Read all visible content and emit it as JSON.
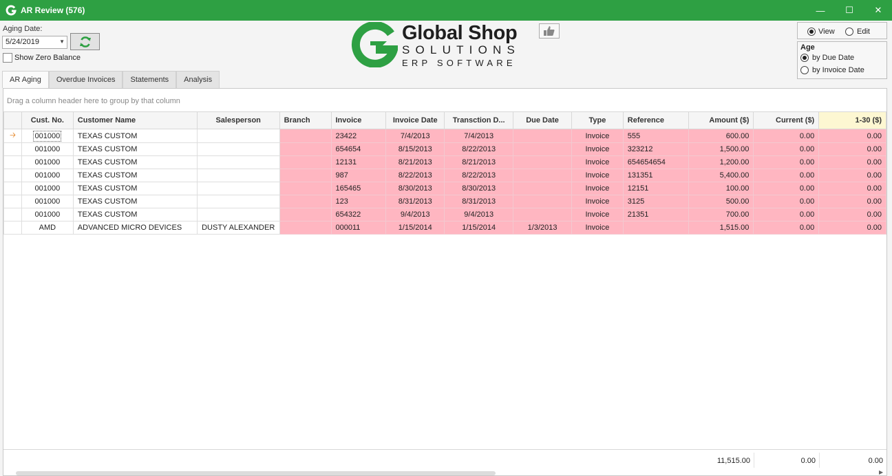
{
  "window": {
    "title": "AR Review (576)"
  },
  "aging": {
    "label": "Aging Date:",
    "date": "5/24/2019",
    "show_zero_label": "Show Zero Balance"
  },
  "logo": {
    "line1": "Global Shop",
    "line2": "SOLUTIONS",
    "line3": "ERP SOFTWARE"
  },
  "mode": {
    "view": "View",
    "edit": "Edit"
  },
  "age": {
    "title": "Age",
    "by_due": "by Due Date",
    "by_invoice": "by Invoice Date"
  },
  "tabs": [
    "AR Aging",
    "Overdue Invoices",
    "Statements",
    "Analysis"
  ],
  "grid": {
    "group_hint": "Drag a column header here to group by that column",
    "columns": [
      "Cust. No.",
      "Customer Name",
      "Salesperson",
      "Branch",
      "Invoice",
      "Invoice Date",
      "Transction D...",
      "Due Date",
      "Type",
      "Reference",
      "Amount ($)",
      "Current ($)",
      "1-30 ($)"
    ],
    "rows": [
      [
        "001000",
        "TEXAS CUSTOM",
        "",
        "",
        "23422",
        "7/4/2013",
        "7/4/2013",
        "",
        "Invoice",
        "555",
        "600.00",
        "0.00",
        "0.00"
      ],
      [
        "001000",
        "TEXAS CUSTOM",
        "",
        "",
        "654654",
        "8/15/2013",
        "8/22/2013",
        "",
        "Invoice",
        "323212",
        "1,500.00",
        "0.00",
        "0.00"
      ],
      [
        "001000",
        "TEXAS CUSTOM",
        "",
        "",
        "12131",
        "8/21/2013",
        "8/21/2013",
        "",
        "Invoice",
        "654654654",
        "1,200.00",
        "0.00",
        "0.00"
      ],
      [
        "001000",
        "TEXAS CUSTOM",
        "",
        "",
        "987",
        "8/22/2013",
        "8/22/2013",
        "",
        "Invoice",
        "131351",
        "5,400.00",
        "0.00",
        "0.00"
      ],
      [
        "001000",
        "TEXAS CUSTOM",
        "",
        "",
        "165465",
        "8/30/2013",
        "8/30/2013",
        "",
        "Invoice",
        "12151",
        "100.00",
        "0.00",
        "0.00"
      ],
      [
        "001000",
        "TEXAS CUSTOM",
        "",
        "",
        "123",
        "8/31/2013",
        "8/31/2013",
        "",
        "Invoice",
        "3125",
        "500.00",
        "0.00",
        "0.00"
      ],
      [
        "001000",
        "TEXAS CUSTOM",
        "",
        "",
        "654322",
        "9/4/2013",
        "9/4/2013",
        "",
        "Invoice",
        "21351",
        "700.00",
        "0.00",
        "0.00"
      ],
      [
        "AMD",
        "ADVANCED MICRO DEVICES",
        "DUSTY ALEXANDER",
        "",
        "000011",
        "1/15/2014",
        "1/15/2014",
        "1/3/2013",
        "Invoice",
        "",
        "1,515.00",
        "0.00",
        "0.00"
      ]
    ],
    "totals": {
      "amount": "11,515.00",
      "current": "0.00",
      "d1_30": "0.00"
    }
  },
  "colors": {
    "titlebar": "#2ea043",
    "row_highlight": "#ffb6c1",
    "logo_green": "#2ea043"
  }
}
